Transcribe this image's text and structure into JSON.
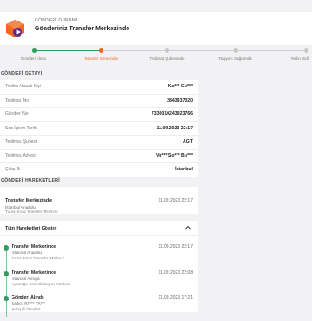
{
  "status": {
    "caption": "GÖNDERİ DURUMU",
    "title": "Gönderiniz Transfer Merkezinde",
    "accent": "#f26522"
  },
  "steps": [
    {
      "label": "Gönderi Alındı",
      "state": "done"
    },
    {
      "label": "Transfer Sürecinde",
      "state": "active"
    },
    {
      "label": "Teslimat Şubesinde",
      "state": "pending"
    },
    {
      "label": "Taşıyıcı Dağıtımda",
      "state": "pending"
    },
    {
      "label": "Teslim Edil",
      "state": "pending"
    }
  ],
  "details": {
    "header": "GÖNDERİ DETAYI",
    "rows": [
      {
        "label": "Teslim Alacak Kişi",
        "value": "Ka*** Gü***"
      },
      {
        "label": "Teslimat No",
        "value": "2843937020"
      },
      {
        "label": "Gönderi No",
        "value": "7330010243923766"
      },
      {
        "label": "Son İşlem Tarihi",
        "value": "11.09.2023 22:17"
      },
      {
        "label": "Teslimat Şubesi",
        "value": "AGT"
      },
      {
        "label": "Teslimat Adresi",
        "value": "Vu*** So*** Bu***"
      },
      {
        "label": "Çıkış İli",
        "value": "İstanbul"
      }
    ]
  },
  "movements": {
    "header": "GÖNDERİ HAREKETLERİ",
    "last": {
      "title": "Transfer Merkezinde",
      "time": "11.09.2023 22:17",
      "line1": "İstanbul Anadolu",
      "line2": "Tuzla-Kiraz Transfer Merkezi"
    },
    "toggle_label": "Tüm Hareketleri Göster",
    "items": [
      {
        "title": "Transfer Merkezinde",
        "time": "11.09.2023 22:17",
        "line1": "İstanbul Anadolu",
        "line2": "Tuzla-Kiraz Transfer Merkezi"
      },
      {
        "title": "Transfer Merkezinde",
        "time": "11.09.2023 22:08",
        "line1": "İstanbul Avrupa",
        "line2": "Ayazağa Konsolidasyon Merkezi"
      },
      {
        "title": "Gönderi Alındı",
        "time": "11.09.2023 17:21",
        "line1": "Satıcı: Rh*** YA***",
        "line2": "Çıkış İli İstanbul"
      }
    ]
  },
  "colors": {
    "done": "#2e9e5b",
    "active": "#f26522",
    "pending": "#c8c8c8"
  }
}
